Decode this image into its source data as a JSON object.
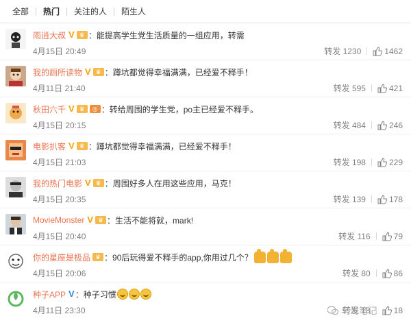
{
  "tabs": [
    {
      "label": "全部"
    },
    {
      "label": "热门"
    },
    {
      "label": "关注的人"
    },
    {
      "label": "陌生人"
    }
  ],
  "comments": [
    {
      "user": "雨逍大叔",
      "text": "能提高学生党生活质量的一组应用，转需",
      "date": "4月15日 20:49",
      "repost": "转发 1230",
      "likes": "1462"
    },
    {
      "user": "我的厕所读物",
      "text": "蹲坑都觉得幸福满满，已经爱不释手！",
      "date": "4月11日 21:40",
      "repost": "转发 595",
      "likes": "421"
    },
    {
      "user": "秋田六千",
      "text": "转给周围的学生党，po主已经爱不释手。",
      "date": "4月15日 20:15",
      "repost": "转发 484",
      "likes": "246"
    },
    {
      "user": "电影扒客",
      "text": "蹲坑都觉得幸福满满，已经爱不释手！",
      "date": "4月15日 21:03",
      "repost": "转发 198",
      "likes": "229"
    },
    {
      "user": "我的热门电影",
      "text": "周围好多人在用这些应用，马克！",
      "date": "4月15日 20:35",
      "repost": "转发 139",
      "likes": "178"
    },
    {
      "user": "MovieMonster",
      "text": "生活不能将就，mark!",
      "date": "4月15日 20:40",
      "repost": "转发 116",
      "likes": "79"
    },
    {
      "user": "你的星座是极品",
      "text": "90后玩得爱不释手的app,你用过几个？",
      "date": "4月15日 20:06",
      "repost": "转发 80",
      "likes": "86"
    },
    {
      "user": "种子APP",
      "text": "种子习惯",
      "date": "4月11日 23:30",
      "repost": "转发 18",
      "likes": "18"
    }
  ],
  "watermark": "鸟哥笔记",
  "colors": {
    "username": "#eb7350",
    "meta": "#808080",
    "badge_gold": "#f2a30c",
    "badge_blue": "#2b8ae0"
  }
}
